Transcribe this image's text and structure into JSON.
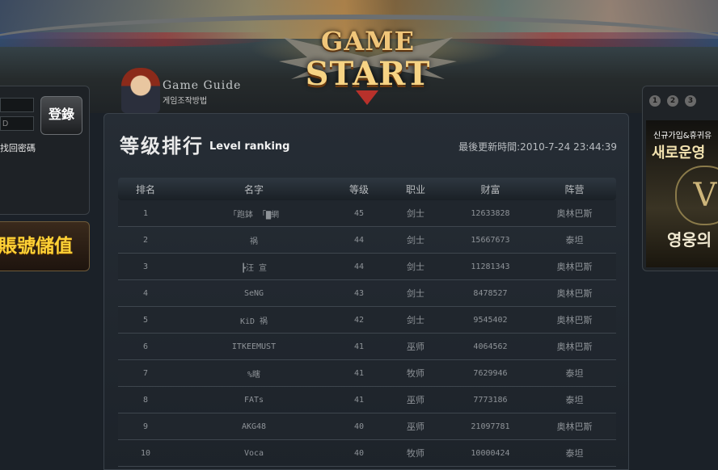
{
  "banner": {
    "logo_line1": "GAME",
    "logo_line2": "START"
  },
  "guide": {
    "title": "Game Guide",
    "subtitle": "게임조작방법"
  },
  "login": {
    "username_value": "",
    "password_value": "D",
    "login_button": "登錄",
    "forgot_text": "找回密碼"
  },
  "recharge_label": "賬號儲值",
  "right_panel": {
    "dots": [
      "1",
      "2",
      "3"
    ],
    "ad_line1": "신규가입&휴귀유",
    "ad_line2": "새로운영",
    "ad_emblem": "V",
    "ad_line3": "영웅의"
  },
  "ranking": {
    "title_cn": "等级排行",
    "title_en": "Level ranking",
    "updated": "最後更新時間:2010-7-24 23:44:39",
    "columns": [
      "排名",
      "名字",
      "等级",
      "职业",
      "财富",
      "阵营"
    ],
    "rows": [
      {
        "rank": "1",
        "name": "「跑鉢 「▇網",
        "level": "45",
        "job": "剑士",
        "wealth": "12633828",
        "camp": "奥林巴斯"
      },
      {
        "rank": "2",
        "name": "祸",
        "level": "44",
        "job": "剑士",
        "wealth": "15667673",
        "camp": "泰坦"
      },
      {
        "rank": "3",
        "name": "┣汪 宣",
        "level": "44",
        "job": "剑士",
        "wealth": "11281343",
        "camp": "奥林巴斯"
      },
      {
        "rank": "4",
        "name": "SeNG",
        "level": "43",
        "job": "剑士",
        "wealth": "8478527",
        "camp": "奥林巴斯"
      },
      {
        "rank": "5",
        "name": "KiD 祸",
        "level": "42",
        "job": "剑士",
        "wealth": "9545402",
        "camp": "奥林巴斯"
      },
      {
        "rank": "6",
        "name": "ITKEEMUST",
        "level": "41",
        "job": "巫师",
        "wealth": "4064562",
        "camp": "奥林巴斯"
      },
      {
        "rank": "7",
        "name": "%瞎",
        "level": "41",
        "job": "牧师",
        "wealth": "7629946",
        "camp": "泰坦"
      },
      {
        "rank": "8",
        "name": "FATs",
        "level": "41",
        "job": "巫师",
        "wealth": "7773186",
        "camp": "泰坦"
      },
      {
        "rank": "9",
        "name": "AKG48",
        "level": "40",
        "job": "巫师",
        "wealth": "21097781",
        "camp": "奥林巴斯"
      },
      {
        "rank": "10",
        "name": "Voca",
        "level": "40",
        "job": "牧师",
        "wealth": "10000424",
        "camp": "泰坦"
      }
    ]
  }
}
